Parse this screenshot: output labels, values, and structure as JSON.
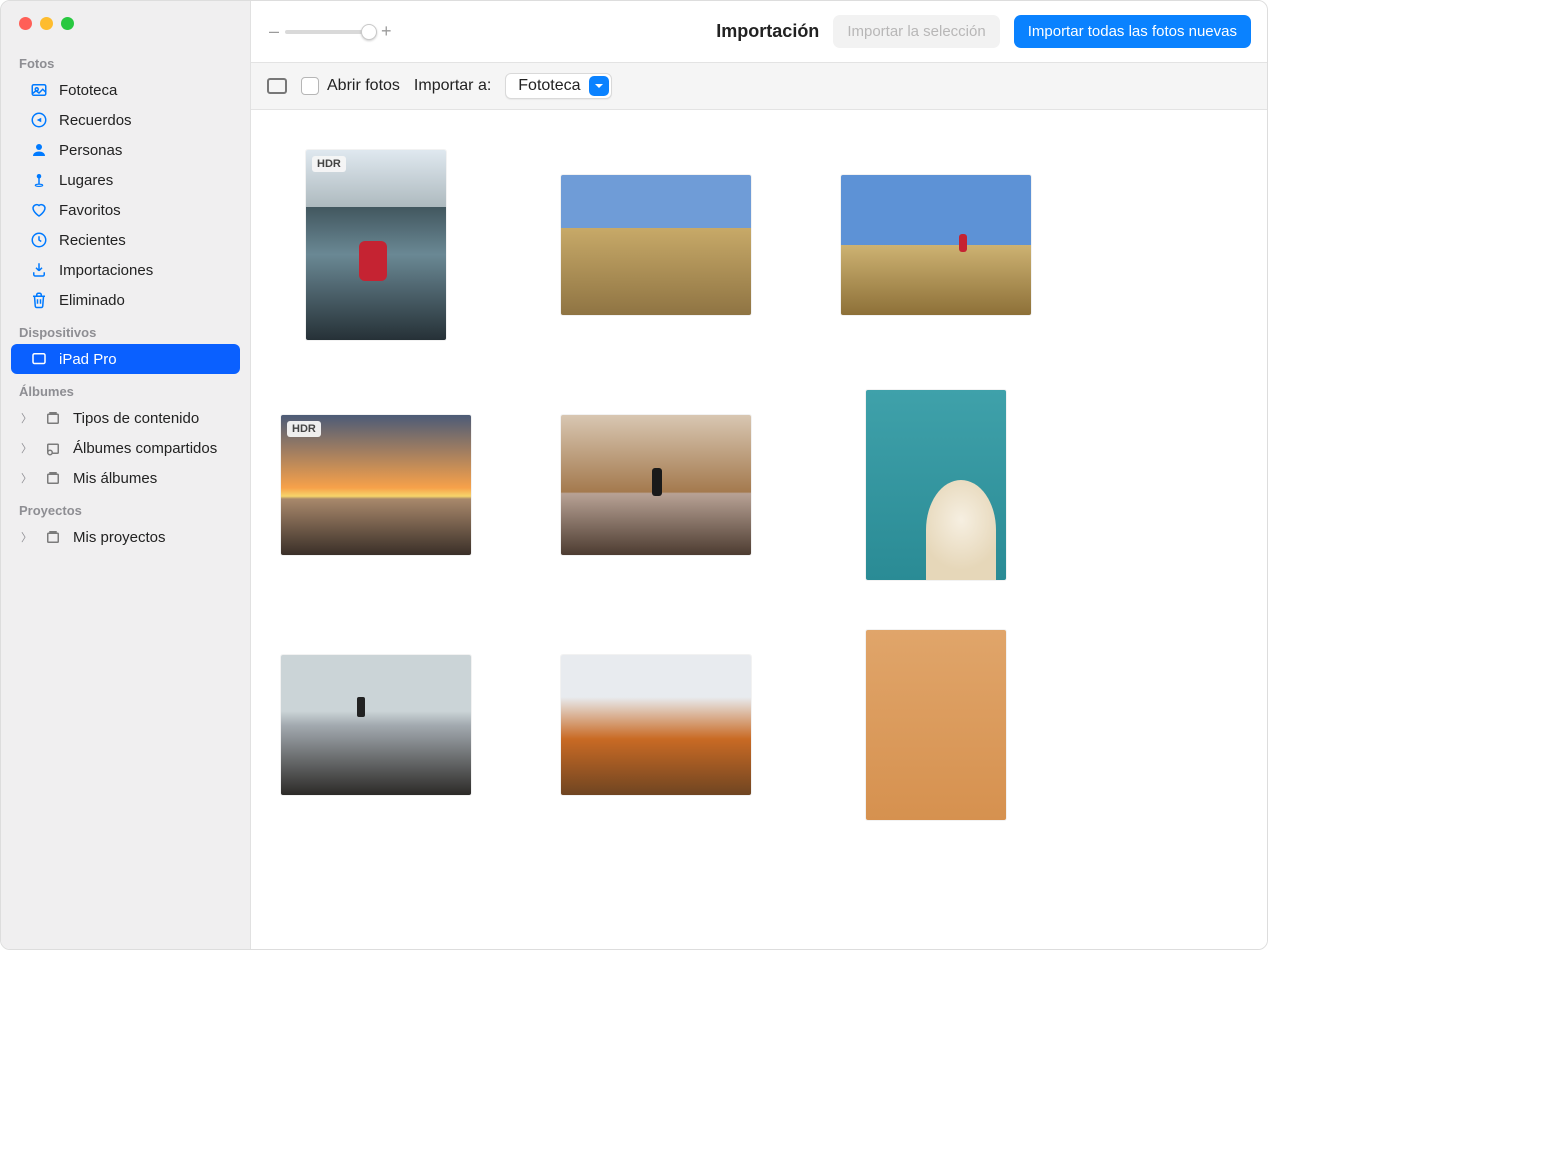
{
  "sidebar": {
    "sections": {
      "fotos": {
        "header": "Fotos",
        "items": [
          {
            "label": "Fototeca",
            "icon": "photo-library-icon"
          },
          {
            "label": "Recuerdos",
            "icon": "memories-icon"
          },
          {
            "label": "Personas",
            "icon": "people-icon"
          },
          {
            "label": "Lugares",
            "icon": "places-icon"
          },
          {
            "label": "Favoritos",
            "icon": "heart-icon"
          },
          {
            "label": "Recientes",
            "icon": "clock-icon"
          },
          {
            "label": "Importaciones",
            "icon": "import-icon"
          },
          {
            "label": "Eliminado",
            "icon": "trash-icon"
          }
        ]
      },
      "dispositivos": {
        "header": "Dispositivos",
        "items": [
          {
            "label": "iPad Pro",
            "icon": "tablet-icon",
            "selected": true
          }
        ]
      },
      "albumes": {
        "header": "Álbumes",
        "items": [
          {
            "label": "Tipos de contenido",
            "icon": "album-icon"
          },
          {
            "label": "Álbumes compartidos",
            "icon": "shared-album-icon"
          },
          {
            "label": "Mis álbumes",
            "icon": "album-icon"
          }
        ]
      },
      "proyectos": {
        "header": "Proyectos",
        "items": [
          {
            "label": "Mis proyectos",
            "icon": "album-icon"
          }
        ]
      }
    }
  },
  "toolbar": {
    "zoom_minus": "–",
    "zoom_plus": "+",
    "title": "Importación",
    "import_selection": "Importar la selección",
    "import_all": "Importar todas las fotos nuevas"
  },
  "subbar": {
    "open_photos": "Abrir fotos",
    "import_to_label": "Importar a:",
    "import_to_value": "Fototeca"
  },
  "thumbnails": [
    {
      "orientation": "portrait",
      "badge": "HDR",
      "imgclass": "img1"
    },
    {
      "orientation": "landscape",
      "badge": null,
      "imgclass": "img2"
    },
    {
      "orientation": "landscape",
      "badge": null,
      "imgclass": "img3"
    },
    {
      "orientation": "landscape",
      "badge": "HDR",
      "imgclass": "img4"
    },
    {
      "orientation": "landscape",
      "badge": null,
      "imgclass": "img5"
    },
    {
      "orientation": "portrait",
      "badge": null,
      "imgclass": "img6"
    },
    {
      "orientation": "landscape",
      "badge": null,
      "imgclass": "img7"
    },
    {
      "orientation": "landscape",
      "badge": null,
      "imgclass": "img8"
    },
    {
      "orientation": "portrait",
      "badge": null,
      "imgclass": "img9"
    }
  ],
  "colors": {
    "accent": "#0a82ff",
    "selection": "#0a60ff"
  }
}
